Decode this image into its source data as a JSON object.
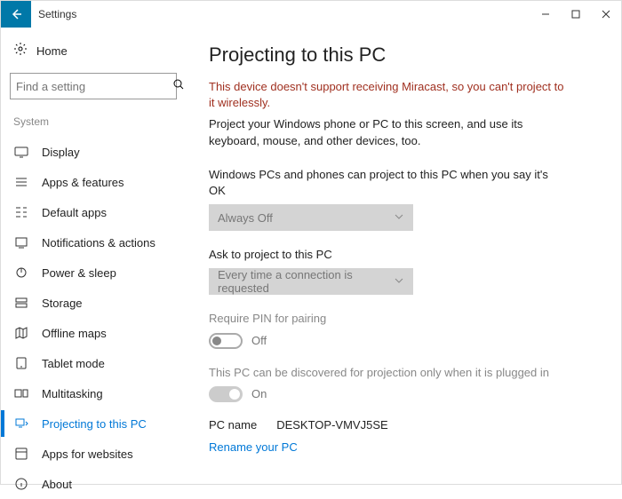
{
  "window": {
    "title": "Settings"
  },
  "sidebar": {
    "home": "Home",
    "search_placeholder": "Find a setting",
    "group": "System",
    "items": [
      {
        "label": "Display"
      },
      {
        "label": "Apps & features"
      },
      {
        "label": "Default apps"
      },
      {
        "label": "Notifications & actions"
      },
      {
        "label": "Power & sleep"
      },
      {
        "label": "Storage"
      },
      {
        "label": "Offline maps"
      },
      {
        "label": "Tablet mode"
      },
      {
        "label": "Multitasking"
      },
      {
        "label": "Projecting to this PC"
      },
      {
        "label": "Apps for websites"
      },
      {
        "label": "About"
      }
    ]
  },
  "main": {
    "title": "Projecting to this PC",
    "warning": "This device doesn't support receiving Miracast, so you can't project to it wirelessly.",
    "desc": "Project your Windows phone or PC to this screen, and use its keyboard, mouse, and other devices, too.",
    "field1_label": "Windows PCs and phones can project to this PC when you say it's OK",
    "field1_value": "Always Off",
    "field2_label": "Ask to project to this PC",
    "field2_value": "Every time a connection is requested",
    "field3_label": "Require PIN for pairing",
    "field3_value": "Off",
    "field4_label": "This PC can be discovered for projection only when it is plugged in",
    "field4_value": "On",
    "pcname_label": "PC name",
    "pcname_value": "DESKTOP-VMVJ5SE",
    "link": "Rename your PC"
  }
}
